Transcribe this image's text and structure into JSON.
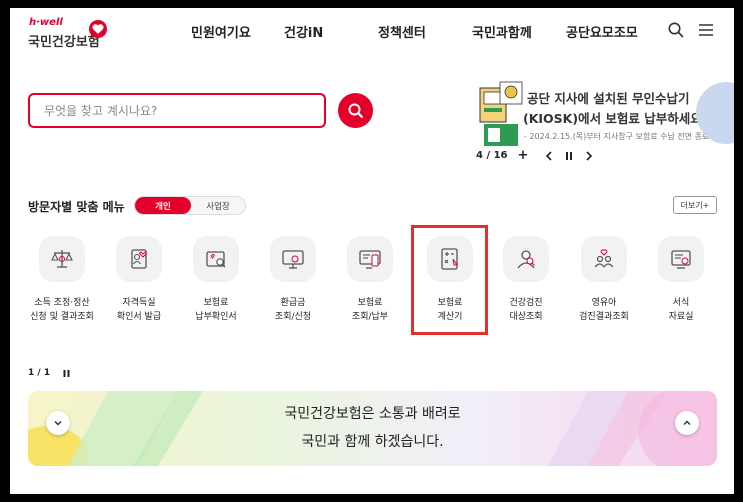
{
  "brand": {
    "small": "h·well",
    "name": "국민건강보험",
    "accent": "#e4002b"
  },
  "nav": [
    "민원여기요",
    "건강iN",
    "정책센터",
    "국민과함께",
    "공단요모조모"
  ],
  "header_icons": [
    "search-icon",
    "menu-icon"
  ],
  "search": {
    "placeholder": "무엇을 찾고 계시나요?"
  },
  "banner": {
    "line1": "공단 지사에 설치된 무인수납기",
    "line2": "(KIOSK)에서 보험료 납부하세요!",
    "sub": "- 2024.2.15.(목)부터 지사창구 보험료 수납 전면 종료 -",
    "current": "4",
    "total": "16",
    "counter_sep": "/",
    "plus": "+"
  },
  "quick_menu": {
    "title": "방문자별 맞춤 메뉴",
    "toggle": [
      "개인",
      "사업장"
    ],
    "more": "더보기+",
    "items": [
      {
        "lines": [
          "소득 조정·정산",
          "신청 및 결과조회"
        ],
        "icon": "scale-icon"
      },
      {
        "lines": [
          "자격득실",
          "확인서 발급"
        ],
        "icon": "certificate-icon"
      },
      {
        "lines": [
          "보험료",
          "납부확인서"
        ],
        "icon": "receipt-search-icon"
      },
      {
        "lines": [
          "환급금",
          "조회/신청"
        ],
        "icon": "refund-monitor-icon"
      },
      {
        "lines": [
          "보험료",
          "조회/납부"
        ],
        "icon": "payment-card-icon"
      },
      {
        "lines": [
          "보험료",
          "계산기"
        ],
        "icon": "calculator-icon"
      },
      {
        "lines": [
          "건강검진",
          "대상조회"
        ],
        "icon": "checkup-user-icon"
      },
      {
        "lines": [
          "영유아",
          "검진결과조회"
        ],
        "icon": "family-heart-icon"
      },
      {
        "lines": [
          "서식",
          "자료실"
        ],
        "icon": "document-form-icon"
      }
    ],
    "highlight_color": "#e4302b"
  },
  "pager": {
    "label": "1 / 1"
  },
  "notice": {
    "line1": "국민건강보험은 소통과 배려로",
    "line2": "국민과 함께 하겠습니다."
  }
}
